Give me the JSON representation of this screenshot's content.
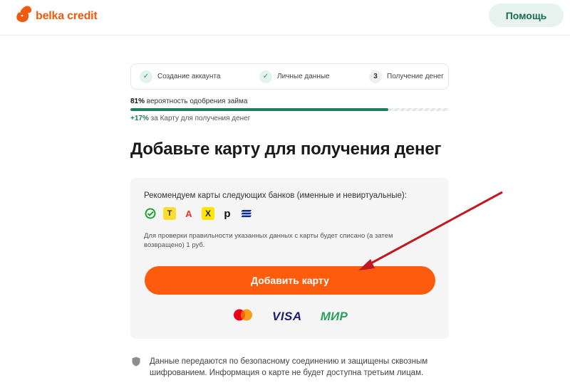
{
  "header": {
    "logo_text": "belka credit",
    "help_label": "Помощь"
  },
  "steps": [
    {
      "label": "Создание аккаунта",
      "state": "done"
    },
    {
      "label": "Личные данные",
      "state": "done"
    },
    {
      "label": "Получение денег",
      "state": "current",
      "number": "3"
    }
  ],
  "probability": {
    "percent": "81%",
    "text": " вероятность одобрения займа",
    "progress": 0.81,
    "boost_percent": "+17%",
    "boost_text": " за Карту для получения денег"
  },
  "title": "Добавьте карту для получения денег",
  "card_box": {
    "recommend": "Рекомендуем карты следующих банков (именные и невиртуальные):",
    "banks": [
      "sber-icon",
      "tbank-icon",
      "alfa-icon",
      "raiffeisen-icon",
      "pochta-icon",
      "vtb-icon"
    ],
    "note": "Для проверки правильности указанных данных с карты будет списано (а затем возвращено) 1 руб.",
    "add_button": "Добавить карту",
    "visa": "VISA",
    "mir": "МИР"
  },
  "security": "Данные передаются по безопасному соединению и защищены сквозным шифрованием. Информация о карте не будет доступна третьим лицам.",
  "colors": {
    "accent": "#fd5c0c",
    "green": "#1b7f5c",
    "help_bg": "#e6f3ee"
  }
}
